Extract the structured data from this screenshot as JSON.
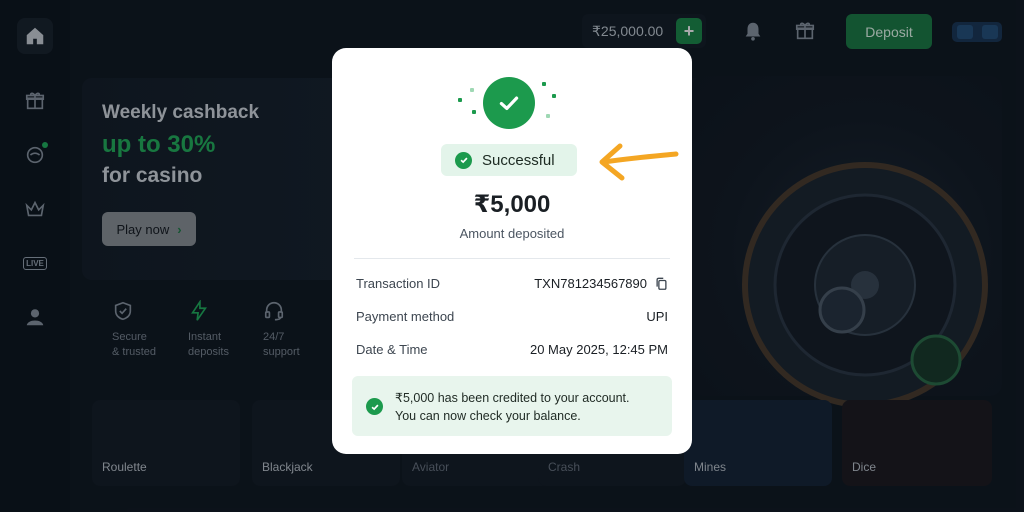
{
  "sidebar": {
    "items": [
      {
        "name": "home",
        "icon": "home-icon"
      },
      {
        "name": "promotions",
        "icon": "gift-icon"
      },
      {
        "name": "sports",
        "icon": "ball-icon"
      },
      {
        "name": "vip",
        "icon": "crown-icon"
      },
      {
        "name": "live",
        "icon": "live-icon",
        "label": "LIVE"
      },
      {
        "name": "profile",
        "icon": "user-icon"
      }
    ]
  },
  "header": {
    "balance": "₹25,000.00",
    "add_label": "+",
    "deposit_label": "Deposit"
  },
  "banner": {
    "title": "Weekly cashback",
    "accent": "up to 30%",
    "subtitle": "for casino",
    "cta_label": "Play now",
    "cta_chevron": "›"
  },
  "features": [
    {
      "icon": "shield-icon",
      "line1": "Secure",
      "line2": "& trusted"
    },
    {
      "icon": "lightning-icon",
      "line1": "Instant",
      "line2": "deposits"
    },
    {
      "icon": "headset-icon",
      "line1": "24/7",
      "line2": "support"
    }
  ],
  "games": [
    {
      "label": "Roulette"
    },
    {
      "label": "Blackjack"
    },
    {
      "label": "Aviator"
    },
    {
      "label": "Crash"
    },
    {
      "label": "Mines"
    },
    {
      "label": "Dice"
    }
  ],
  "modal": {
    "status": "Successful",
    "amount": "₹5,000",
    "amount_caption": "Amount deposited",
    "details": [
      {
        "label": "Transaction ID",
        "value": "TXN781234567890"
      },
      {
        "label": "Payment method",
        "value": "UPI"
      },
      {
        "label": "Date & Time",
        "value": "20 May 2025, 12:45 PM"
      }
    ],
    "notice_line1": "₹5,000 has been credited to your account.",
    "notice_line2": "You can now check your balance."
  },
  "colors": {
    "accent_green": "#1c9a4d",
    "arrow_orange": "#f4a623",
    "background": "#0f1720"
  }
}
